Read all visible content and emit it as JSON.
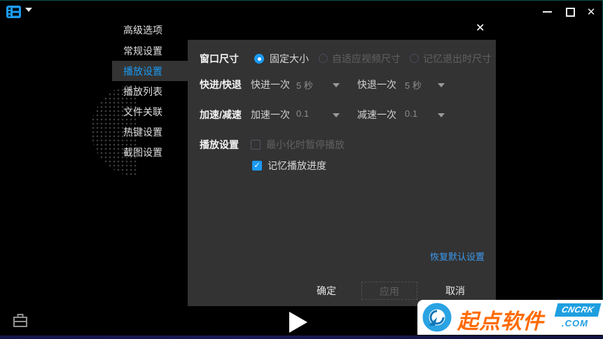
{
  "icons": {
    "caret_down": "▼",
    "check": "✓",
    "close": "✕"
  },
  "titlebar": {
    "app_icon": "filmstrip-icon",
    "minimize_icon": "minimize-icon",
    "maximize_icon": "maximize-icon",
    "close_icon": "close-icon"
  },
  "dialog": {
    "title": "高级选项",
    "sidebar": {
      "items": [
        {
          "label": "常规设置",
          "selected": false
        },
        {
          "label": "播放设置",
          "selected": true
        },
        {
          "label": "播放列表",
          "selected": false
        },
        {
          "label": "文件关联",
          "selected": false
        },
        {
          "label": "热键设置",
          "selected": false
        },
        {
          "label": "截图设置",
          "selected": false
        }
      ]
    },
    "window_size": {
      "label": "窗口尺寸",
      "options": [
        {
          "label": "固定大小",
          "selected": true,
          "enabled": true
        },
        {
          "label": "自适应视频尺寸",
          "selected": false,
          "enabled": false
        },
        {
          "label": "记忆退出时尺寸",
          "selected": false,
          "enabled": false
        }
      ]
    },
    "seek": {
      "label": "快进/快退",
      "forward": {
        "label": "快进一次",
        "value": "5 秒"
      },
      "backward": {
        "label": "快退一次",
        "value": "5 秒"
      }
    },
    "speed": {
      "label": "加速/减速",
      "up": {
        "label": "加速一次",
        "value": "0.1"
      },
      "down": {
        "label": "减速一次",
        "value": "0.1"
      }
    },
    "playback": {
      "label": "播放设置",
      "checkboxes": [
        {
          "label": "最小化时暂停播放",
          "checked": false,
          "enabled": false
        },
        {
          "label": "记忆播放进度",
          "checked": true,
          "enabled": true
        }
      ]
    },
    "restore_link": "恢复默认设置",
    "buttons": {
      "ok": "确定",
      "apply": "应用",
      "cancel": "取消"
    }
  },
  "player": {
    "toolbox_icon": "briefcase-icon",
    "play_icon": "play-icon"
  },
  "watermark": {
    "brand": "起点软件",
    "badge_line1": "CNCRK",
    "badge_line2": ".COM"
  },
  "colors": {
    "accent": "#1b9af2",
    "link": "#3d9aed",
    "panel": "#333333",
    "watermark_orange": "#ff6a00",
    "watermark_blue": "#1e9fe0"
  }
}
